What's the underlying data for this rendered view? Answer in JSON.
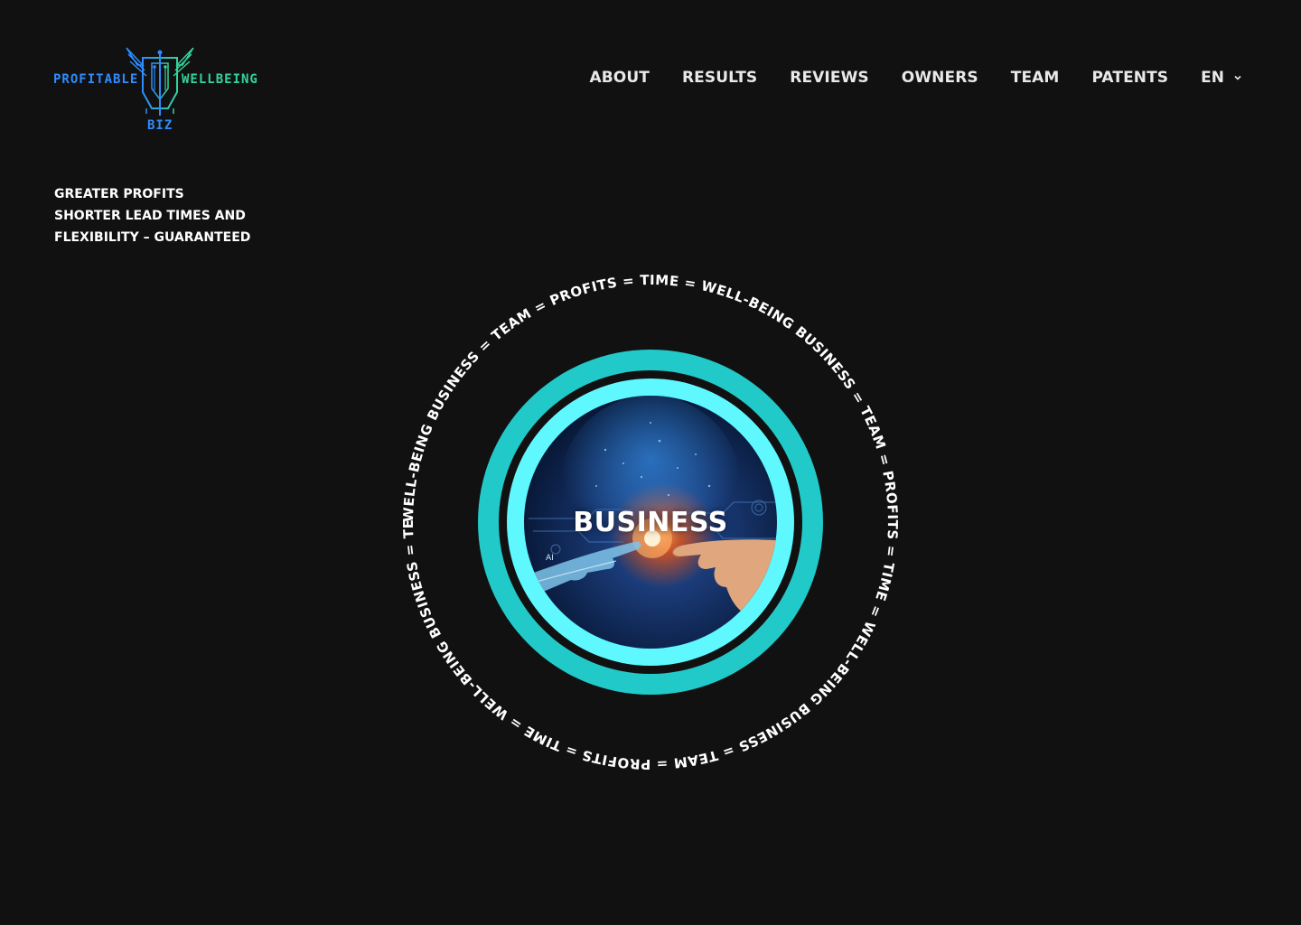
{
  "brand": {
    "word_left": "PROFITABLE",
    "word_right": "WELLBEING",
    "word_bottom": "BIZ",
    "color_blue": "#2f8cff",
    "color_green": "#34d39a"
  },
  "nav": {
    "items": [
      "ABOUT",
      "RESULTS",
      "REVIEWS",
      "OWNERS",
      "TEAM",
      "PATENTS"
    ],
    "language": "EN"
  },
  "tagline": {
    "line1": "GREATER PROFITS",
    "line2": "SHORTER LEAD TIMES AND",
    "line3": "FLEXIBILITY – GUARANTEED"
  },
  "hero": {
    "ring_text": "WELL-BEING BUSINESS = TEAM = PROFITS = TIME = WELL-BEING BUSINESS = TEAM = PROFITS = TIME = WELL-BEING BUSINESS = TEAM = PROFITS = TIME = WELL-BEING BUSINESS = TEAM = PROFITS = TIME = WELL-BEING BUSINESS = TEABUSINESS = TEAM = PROFITS = TIME = ",
    "title": "BUSINESS",
    "image_label": "AI",
    "ring_outer_color": "#22c9c9",
    "ring_inner_color": "#5ff8ff"
  }
}
